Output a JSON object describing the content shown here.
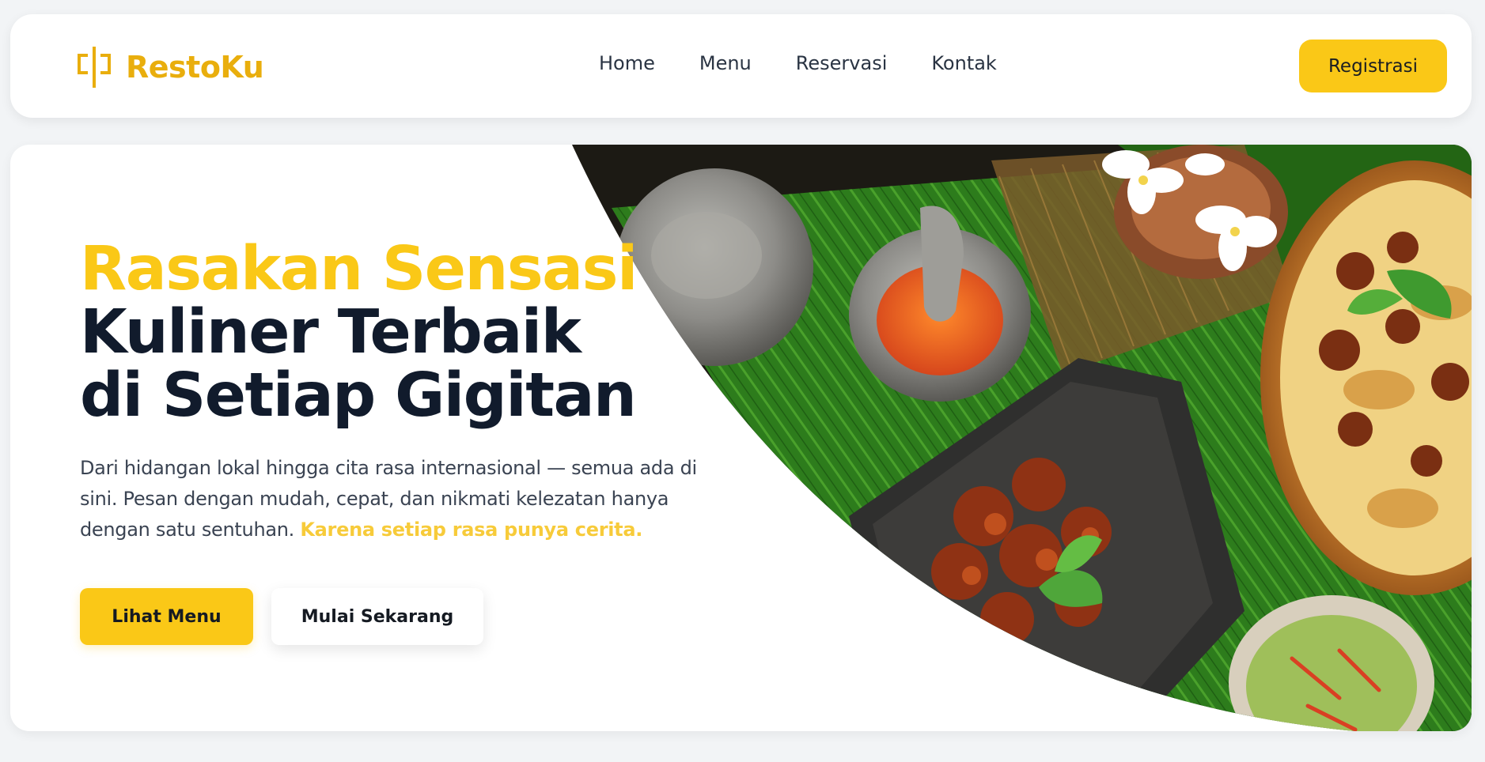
{
  "navbar": {
    "brand": {
      "name": "RestoKu",
      "icon": "logo-bracket-icon"
    },
    "links": [
      {
        "label": "Home"
      },
      {
        "label": "Menu"
      },
      {
        "label": "Reservasi"
      },
      {
        "label": "Kontak"
      }
    ],
    "register_label": "Registrasi"
  },
  "hero": {
    "headline": {
      "line1": "Rasakan Sensasi",
      "line2": "Kuliner Terbaik",
      "line3": "di Setiap Gigitan"
    },
    "description": "Dari hidangan lokal hingga cita rasa internasional — semua ada di sini. Pesan dengan mudah, cepat, dan nikmati kelezatan hanya dengan satu sentuhan.",
    "tagline": "Karena setiap rasa punya cerita.",
    "primary_cta": "Lihat Menu",
    "secondary_cta": "Mulai Sekarang",
    "image": "indonesian-food-spread-photo"
  },
  "colors": {
    "accent": "#fac817",
    "brand": "#e9ae0d",
    "heading": "#111b2c",
    "body_text": "#3a4352",
    "background": "#f2f4f6"
  }
}
